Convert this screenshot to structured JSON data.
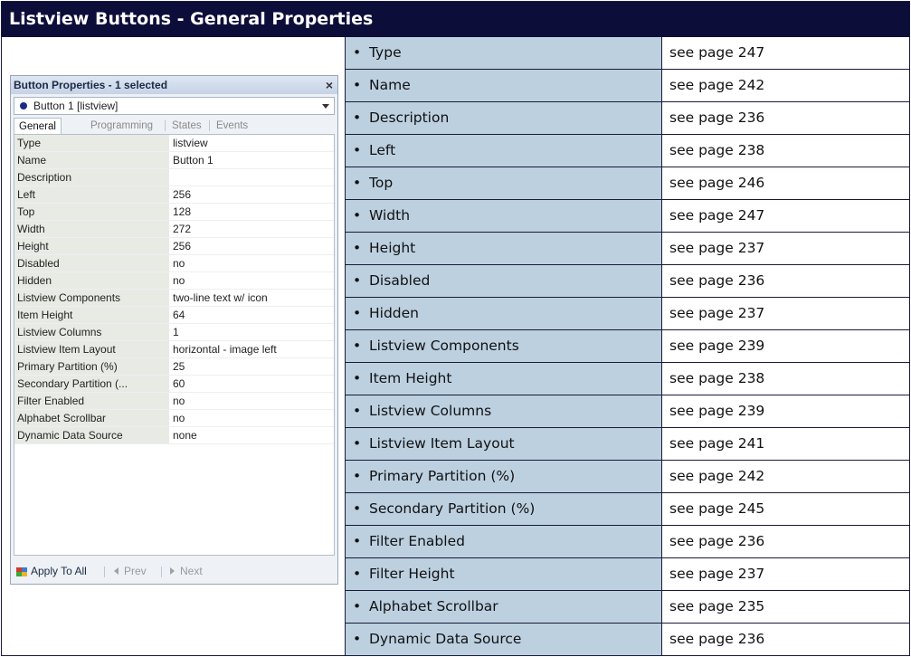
{
  "title": "Listview Buttons - General Properties",
  "properties_panel": {
    "header": "Button Properties - 1 selected",
    "close_glyph": "×",
    "selector_value": "Button 1  [listview]",
    "tabs": [
      "General",
      "Programming",
      "States",
      "Events"
    ],
    "active_tab": "General",
    "rows": [
      {
        "name": "Type",
        "value": "listview"
      },
      {
        "name": "Name",
        "value": "Button 1"
      },
      {
        "name": "Description",
        "value": ""
      },
      {
        "name": "Left",
        "value": "256"
      },
      {
        "name": "Top",
        "value": "128"
      },
      {
        "name": "Width",
        "value": "272"
      },
      {
        "name": "Height",
        "value": "256"
      },
      {
        "name": "Disabled",
        "value": "no"
      },
      {
        "name": "Hidden",
        "value": "no"
      },
      {
        "name": "Listview Components",
        "value": "two-line text w/ icon"
      },
      {
        "name": "Item Height",
        "value": "64"
      },
      {
        "name": "Listview Columns",
        "value": "1"
      },
      {
        "name": "Listview Item Layout",
        "value": "horizontal - image left"
      },
      {
        "name": "Primary Partition (%)",
        "value": "25"
      },
      {
        "name": "Secondary Partition (...",
        "value": "60"
      },
      {
        "name": "Filter Enabled",
        "value": "no"
      },
      {
        "name": "Alphabet Scrollbar",
        "value": "no"
      },
      {
        "name": "Dynamic Data Source",
        "value": "none"
      }
    ],
    "footer": {
      "apply_label": "Apply To All",
      "prev_label": "Prev",
      "next_label": "Next"
    }
  },
  "reference_rows": [
    {
      "property": "Type",
      "page": "see page 247"
    },
    {
      "property": "Name",
      "page": "see page 242"
    },
    {
      "property": "Description",
      "page": "see page 236"
    },
    {
      "property": "Left",
      "page": "see page 238"
    },
    {
      "property": "Top",
      "page": "see page 246"
    },
    {
      "property": "Width",
      "page": "see page 247"
    },
    {
      "property": "Height",
      "page": "see page 237"
    },
    {
      "property": "Disabled",
      "page": "see page 236"
    },
    {
      "property": "Hidden",
      "page": "see page 237"
    },
    {
      "property": "Listview Components",
      "page": "see page 239"
    },
    {
      "property": "Item Height",
      "page": "see page 238"
    },
    {
      "property": "Listview Columns",
      "page": "see page 239"
    },
    {
      "property": "Listview Item Layout",
      "page": "see page 241"
    },
    {
      "property": "Primary Partition (%)",
      "page": "see page 242"
    },
    {
      "property": "Secondary Partition (%)",
      "page": "see page 245"
    },
    {
      "property": "Filter Enabled",
      "page": "see page 236"
    },
    {
      "property": "Filter Height",
      "page": "see page 237"
    },
    {
      "property": "Alphabet Scrollbar",
      "page": "see page 235"
    },
    {
      "property": "Dynamic Data Source",
      "page": "see page 236"
    }
  ],
  "bullet": "•",
  "colors": {
    "title_bar": "#0d0d3a",
    "property_cell": "#bcd0e0",
    "grid_name_cell": "#e8ebe4"
  }
}
